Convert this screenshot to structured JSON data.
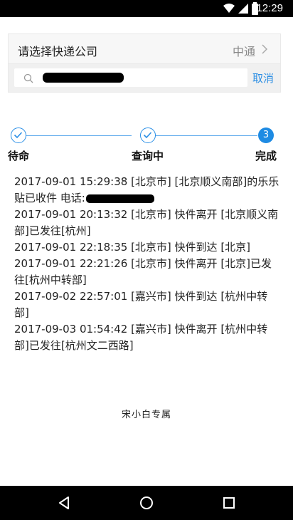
{
  "status_bar": {
    "time": "12:29"
  },
  "company_selector": {
    "label": "请选择快递公司",
    "value": "中通"
  },
  "search": {
    "cancel_label": "取消"
  },
  "steps": [
    {
      "label": "待命",
      "state": "done"
    },
    {
      "label": "查询中",
      "state": "done"
    },
    {
      "label": "完成",
      "state": "current",
      "number": "3"
    }
  ],
  "tracking_entries": [
    {
      "text": "2017-09-01 15:29:38 [北京市] [北京顺义南部]的乐乐贴已收件 电话:",
      "redacted_phone": true
    },
    {
      "text": "2017-09-01 20:13:32 [北京市] 快件离开 [北京顺义南部]已发往[杭州]"
    },
    {
      "text": "2017-09-01 22:18:35 [北京市] 快件到达 [北京]"
    },
    {
      "text": "2017-09-01 22:21:26 [北京市] 快件离开 [北京]已发往[杭州中转部]"
    },
    {
      "text": "2017-09-02 22:57:01 [嘉兴市] 快件到达 [杭州中转部]"
    },
    {
      "text": "2017-09-03 01:54:42 [嘉兴市] 快件离开 [杭州中转部]已发往[杭州文二西路]"
    }
  ],
  "footer": {
    "watermark": "宋小白专属"
  },
  "colors": {
    "accent": "#1e8be3",
    "cancel": "#2c8ee4"
  }
}
